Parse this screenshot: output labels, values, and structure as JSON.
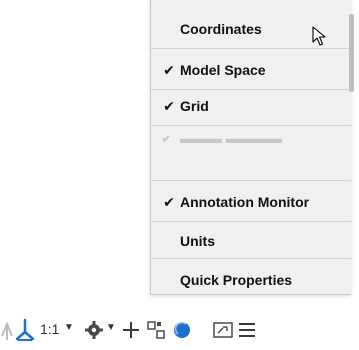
{
  "menu": {
    "items": [
      {
        "label": "Coordinates",
        "checked": false
      },
      {
        "label": "Model Space",
        "checked": true
      },
      {
        "label": "Grid",
        "checked": true
      },
      {
        "label": "Annotation Monitor",
        "checked": true
      },
      {
        "label": "Units",
        "checked": false
      },
      {
        "label": "Quick Properties",
        "checked": false
      }
    ],
    "check_mark": "✔"
  },
  "statusbar": {
    "annotation_scale": "1:1",
    "icons": [
      "select-cycling-icon",
      "annotation-scale-icon",
      "workspace-gear-icon",
      "annotate-add-icon",
      "selection-filter-icon",
      "isolate-objects-icon",
      "fullscreen-icon",
      "customize-menu-icon"
    ]
  },
  "colors": {
    "menu_background": "#f0f0f0",
    "text": "#111111",
    "separator": "#d2d2d2",
    "blue_icon": "#1f6fd1",
    "statusbar_icon": "#4a4a4a"
  }
}
